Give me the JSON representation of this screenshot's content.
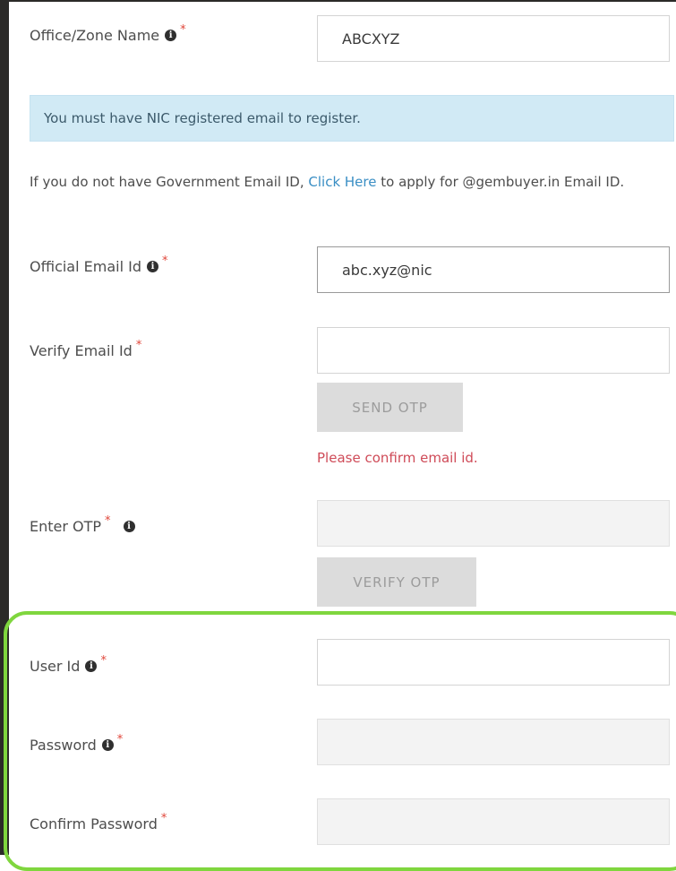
{
  "form": {
    "office_zone_name": {
      "label": "Office/Zone Name",
      "value": "ABCXYZ"
    },
    "alert_text": "You must have NIC registered email to register.",
    "gov_email_note": {
      "before": "If you do not have Government Email ID, ",
      "link": "Click Here",
      "after": " to apply for @gembuyer.in Email ID."
    },
    "official_email": {
      "label": "Official Email Id",
      "value": "abc.xyz@nic"
    },
    "verify_email": {
      "label": "Verify Email Id",
      "value": ""
    },
    "send_otp_label": "SEND OTP",
    "confirm_email_error": "Please confirm email id.",
    "enter_otp": {
      "label": "Enter OTP",
      "value": ""
    },
    "verify_otp_label": "VERIFY OTP",
    "user_id": {
      "label": "User Id",
      "value": ""
    },
    "password": {
      "label": "Password",
      "value": ""
    },
    "confirm_password": {
      "label": "Confirm Password",
      "value": ""
    },
    "required_mark": "*",
    "info_icon_glyph": "i"
  },
  "colors": {
    "highlight_border": "#7fd63e",
    "required": "#e0463a",
    "link": "#3a8ec4",
    "error": "#cf4b58",
    "alert_bg": "#d1eaf5"
  }
}
